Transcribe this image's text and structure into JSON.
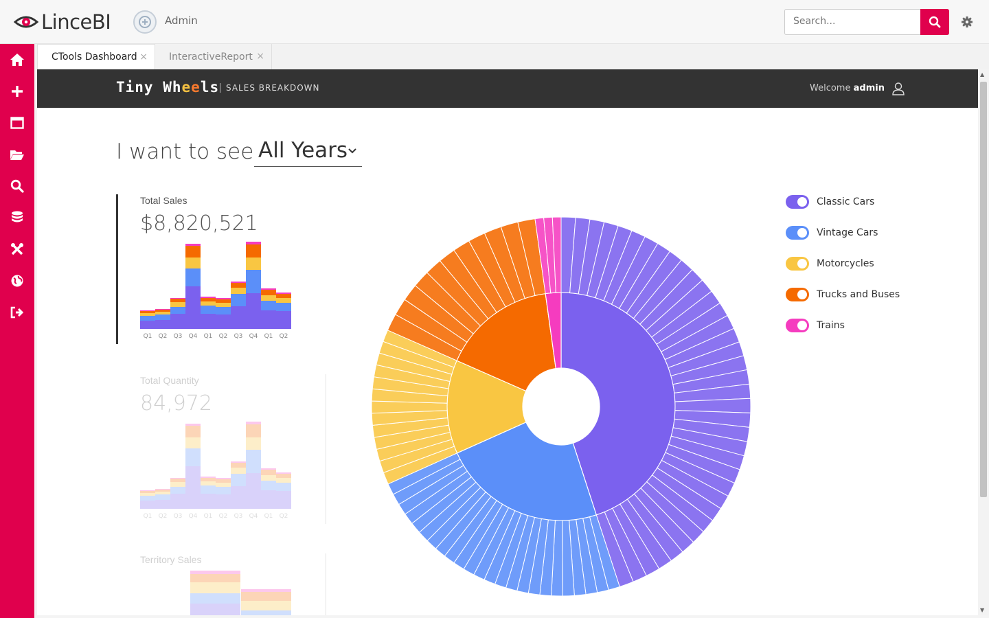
{
  "app": {
    "name": "LinceBI",
    "user": "Admin"
  },
  "search": {
    "placeholder": "Search..."
  },
  "sidebar": {
    "icons": [
      "home-icon",
      "plus-icon",
      "window-icon",
      "folder-icon",
      "search-icon",
      "database-icon",
      "tools-icon",
      "globe-icon",
      "logout-icon"
    ]
  },
  "tabs": [
    {
      "label": "CTools Dashboard",
      "close": "×"
    },
    {
      "label": "InteractiveReport",
      "close": "×"
    }
  ],
  "dashboard": {
    "brand_pre": "Tiny Wh",
    "brand_e1": "e",
    "brand_e2": "e",
    "brand_post": "ls",
    "subtitle": "SALES BREAKDOWN",
    "welcome": "Welcome",
    "welcome_user": "admin",
    "want_label": "I want to see",
    "year_value": "All Years"
  },
  "kpis": [
    {
      "label": "Total Sales",
      "value": "$8,820,521"
    },
    {
      "label": "Total Quantity",
      "value": "84,972"
    },
    {
      "label": "Territory Sales",
      "value": ""
    }
  ],
  "mini_chart": {
    "quarters": [
      "Q1",
      "Q2",
      "Q3",
      "Q4",
      "Q1",
      "Q2",
      "Q3",
      "Q4",
      "Q1",
      "Q2"
    ],
    "stacks": [
      [
        12,
        7,
        4,
        3,
        1
      ],
      [
        13,
        8,
        4,
        3,
        1
      ],
      [
        22,
        10,
        7,
        5,
        1
      ],
      [
        62,
        26,
        16,
        17,
        3
      ],
      [
        22,
        12,
        6,
        5,
        2
      ],
      [
        21,
        11,
        6,
        5,
        2
      ],
      [
        33,
        18,
        9,
        7,
        2
      ],
      [
        52,
        34,
        18,
        19,
        4
      ],
      [
        27,
        14,
        8,
        8,
        2
      ],
      [
        26,
        12,
        7,
        6,
        2
      ]
    ]
  },
  "territory_chart": {
    "stacks": [
      [
        22,
        15,
        16,
        12,
        5
      ],
      [
        0,
        12,
        14,
        13,
        4
      ]
    ]
  },
  "legend": [
    {
      "label": "Classic Cars",
      "color": "#7b61ee"
    },
    {
      "label": "Vintage Cars",
      "color": "#5b8ff9"
    },
    {
      "label": "Motorcycles",
      "color": "#f9c642"
    },
    {
      "label": "Trucks and Buses",
      "color": "#f56a00"
    },
    {
      "label": "Trains",
      "color": "#f53cbf"
    }
  ],
  "chart_data": {
    "type": "pie",
    "series": [
      {
        "name": "Classic Cars",
        "share": 0.45,
        "products": 37
      },
      {
        "name": "Vintage Cars",
        "share": 0.233,
        "products": 24
      },
      {
        "name": "Motorcycles",
        "share": 0.133,
        "products": 13
      },
      {
        "name": "Trucks and Buses",
        "share": 0.162,
        "products": 11
      },
      {
        "name": "Trains",
        "share": 0.022,
        "products": 3
      }
    ]
  },
  "colors": {
    "accent": "#e0004d"
  }
}
